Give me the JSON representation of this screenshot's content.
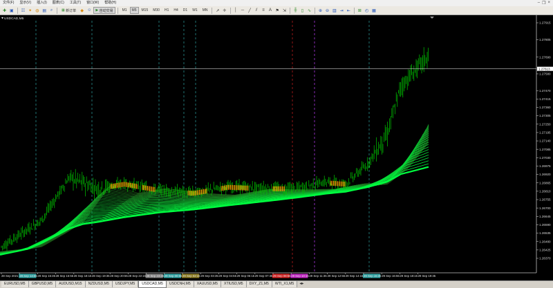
{
  "menubar": {
    "items": [
      "文件(F)",
      "显示(V)",
      "插入(I)",
      "图表(C)",
      "工具(T)",
      "窗口(W)",
      "帮助(H)"
    ]
  },
  "toolbar": {
    "new_order_label": "新订单",
    "auto_trading_label": "自动交易",
    "timeframes": [
      "M1",
      "M5",
      "M15",
      "M30",
      "H1",
      "H4",
      "D1",
      "W1",
      "MN"
    ],
    "active_timeframe": "M5"
  },
  "chart": {
    "symbol_label": "USDCAD,M5",
    "current_price": "1.27613",
    "colors": {
      "background": "#000000",
      "candles": "#00c800",
      "ribbon_low": "#00ff40",
      "ribbon_high": "#1f5c1a",
      "highlight": "#ff9900",
      "grid_dash": "#2fa3a3",
      "v_red": "#d02020",
      "v_purple": "#c040ff"
    },
    "price_axis": [
      "1.27915",
      "1.27805",
      "1.27690",
      "1.27580",
      "1.27470",
      "1.27415",
      "1.27360",
      "1.27305",
      "1.27250",
      "1.27195",
      "1.27140",
      "1.27085",
      "1.27030",
      "1.26975",
      "1.26920",
      "1.26865",
      "1.26810",
      "1.26755",
      "1.26700",
      "1.26645",
      "1.26590",
      "1.26535",
      "1.26480",
      "1.26425",
      "1.26370"
    ],
    "time_axis": [
      {
        "label": "28 Sep 2021",
        "bg": ""
      },
      {
        "label": "28 Sep 14:55",
        "bg": "#2fa3a3"
      },
      {
        "label": "28 Sep 15:35",
        "bg": ""
      },
      {
        "label": "28 Sep 16:55",
        "bg": ""
      },
      {
        "label": "28 Sep 18:15",
        "bg": ""
      },
      {
        "label": "28 Sep 19:35",
        "bg": ""
      },
      {
        "label": "28 Sep 20:55",
        "bg": ""
      },
      {
        "label": "28 Sep 22:15",
        "bg": ""
      },
      {
        "label": "28 Sep 23:35",
        "bg": "#808080"
      },
      {
        "label": "29 Sep 00:55",
        "bg": "#2fa3a3"
      },
      {
        "label": "29 Sep 02:15",
        "bg": "#8a7a20"
      },
      {
        "label": "29 Sep 03:35",
        "bg": ""
      },
      {
        "label": "29 Sep 04:55",
        "bg": ""
      },
      {
        "label": "29 Sep 06:15",
        "bg": ""
      },
      {
        "label": "29 Sep 07:35",
        "bg": ""
      },
      {
        "label": "29 Sep 08:55",
        "bg": "#d02020"
      },
      {
        "label": "29 Sep 10:15",
        "bg": "#c020c0"
      },
      {
        "label": "29 Sep 11:35",
        "bg": ""
      },
      {
        "label": "29 Sep 12:55",
        "bg": ""
      },
      {
        "label": "29 Sep 14:15",
        "bg": ""
      },
      {
        "label": "29 Sep 15:35",
        "bg": "#2fa3a3"
      },
      {
        "label": "29 Sep 16:55",
        "bg": ""
      },
      {
        "label": "29 Sep 18:15",
        "bg": ""
      },
      {
        "label": "29 Sep 19:35",
        "bg": ""
      }
    ]
  },
  "tabs": [
    {
      "label": "EURUSD,M5",
      "active": false
    },
    {
      "label": "GBPUSD,M5",
      "active": false
    },
    {
      "label": "AUDUSD,M15",
      "active": false
    },
    {
      "label": "NZDUSD,M5",
      "active": false
    },
    {
      "label": "USDJPY,M5",
      "active": false
    },
    {
      "label": "USDCAD,M5",
      "active": true
    },
    {
      "label": "USDCNH,M5",
      "active": false
    },
    {
      "label": "XAUUSD,M5",
      "active": false
    },
    {
      "label": "XTIUSD,M5",
      "active": false
    },
    {
      "label": "DXY_Z1,M5",
      "active": false
    },
    {
      "label": "WTI_X1,M5",
      "active": false
    }
  ]
}
